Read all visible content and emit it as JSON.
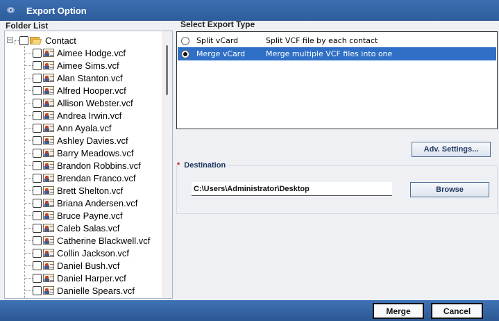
{
  "window": {
    "title": "Export Option",
    "icon": "app-gear-icon"
  },
  "folder_list": {
    "header": "Folder List",
    "root": {
      "label": "Contact",
      "icon": "folder-icon",
      "checked": false,
      "expanded": true
    },
    "items": [
      "Aimee Hodge.vcf",
      "Aimee Sims.vcf",
      "Alan Stanton.vcf",
      "Alfred Hooper.vcf",
      "Allison Webster.vcf",
      "Andrea Irwin.vcf",
      "Ann Ayala.vcf",
      "Ashley Davies.vcf",
      "Barry Meadows.vcf",
      "Brandon Robbins.vcf",
      "Brendan Franco.vcf",
      "Brett Shelton.vcf",
      "Briana Andersen.vcf",
      "Bruce Payne.vcf",
      "Caleb Salas.vcf",
      "Catherine Blackwell.vcf",
      "Collin Jackson.vcf",
      "Daniel Bush.vcf",
      "Daniel Harper.vcf",
      "Danielle Spears.vcf"
    ]
  },
  "export_type": {
    "header": "Select Export Type",
    "options": [
      {
        "name": "Split vCard",
        "description": "Split VCF file by each contact",
        "selected": false
      },
      {
        "name": "Merge vCard",
        "description": "Merge multiple VCF files into one",
        "selected": true
      }
    ]
  },
  "adv_settings_label": "Adv. Settings...",
  "destination": {
    "required_mark": "*",
    "label": "Destination",
    "path": "C:\\Users\\Administrator\\Desktop",
    "browse_label": "Browse"
  },
  "footer": {
    "merge_label": "Merge",
    "cancel_label": "Cancel"
  },
  "colors": {
    "titlebar": "#2e5d9c",
    "selection": "#2f70c6",
    "required": "#c0202a"
  }
}
